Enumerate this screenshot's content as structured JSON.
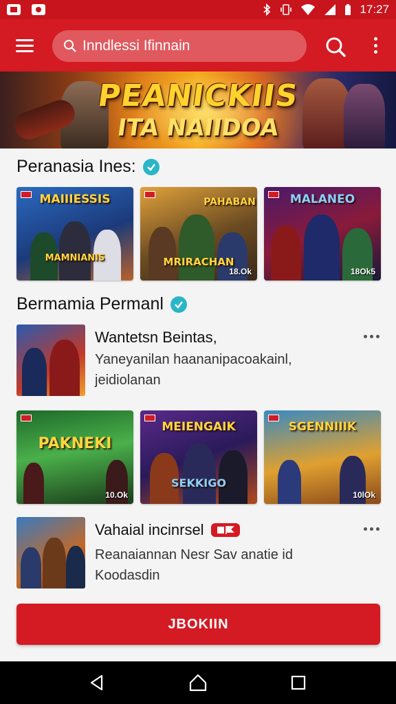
{
  "status_bar": {
    "time": "17:27"
  },
  "search": {
    "text": "Inndlessi Ifinnain"
  },
  "banner": {
    "title": "PEANICKIIS",
    "subtitle": "ITA NAIIDOA"
  },
  "section1": {
    "title": "Peranasia Ines:",
    "tiles": [
      {
        "title": "MAIIIESSIS",
        "caption": "MAMNIANIS",
        "count": ""
      },
      {
        "title": "PAHABAN",
        "caption": "MRIRACHAN",
        "count": "18.Ok"
      },
      {
        "title": "MALANEO",
        "caption": "",
        "count": "18Ok5"
      }
    ]
  },
  "section2": {
    "title": "Bermamia Permanl"
  },
  "list_item1": {
    "title": "Wantetsn Beintas,",
    "line1": "Yaneyanilan haananipacoakainl,",
    "line2": "jeidiolanan"
  },
  "row2": {
    "tiles": [
      {
        "title": "PAKNEKI",
        "caption": "",
        "count": "10.Ok"
      },
      {
        "title": "MEIENGAIK",
        "caption": "SEKKIGO",
        "count": ""
      },
      {
        "title": "SGENNIIIK",
        "caption": "",
        "count": "10lOk"
      }
    ]
  },
  "list_item2": {
    "title": "Vahaial incinrsel",
    "line1": "Reanaiannan Nesr Sav anatie id",
    "line2": "Koodasdin"
  },
  "cta": {
    "label": "JBOKIIN"
  },
  "colors": {
    "primary": "#d41a22",
    "verified": "#2bb5c8"
  }
}
